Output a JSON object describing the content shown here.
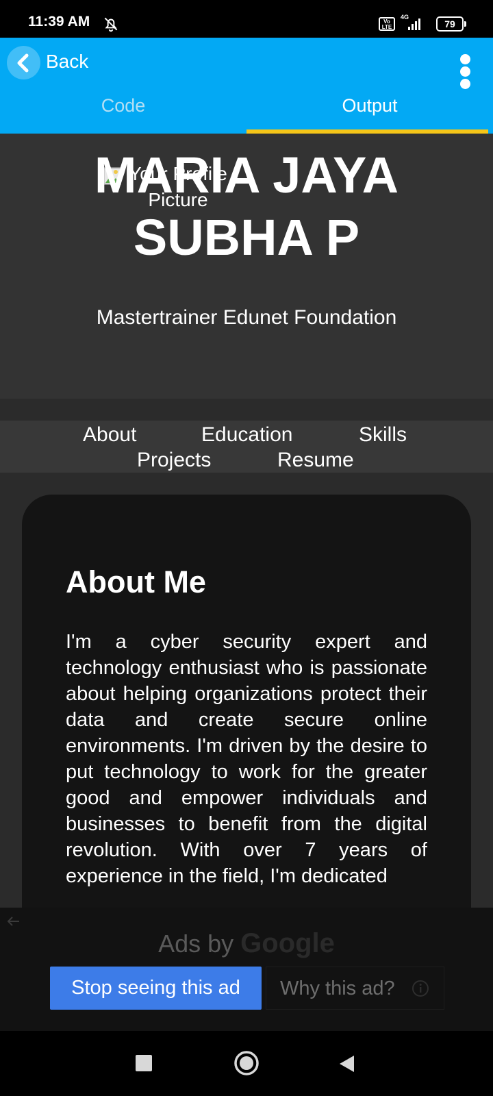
{
  "status_bar": {
    "time": "11:39 AM",
    "volte": "Vo LTE",
    "network": "4G",
    "battery": "79"
  },
  "app_bar": {
    "back_label": "Back",
    "tabs": [
      {
        "label": "Code",
        "selected": false
      },
      {
        "label": "Output",
        "selected": true
      }
    ],
    "accent_color": "#03a9f4",
    "indicator_color": "#f5c518"
  },
  "page": {
    "profile_picture_alt": "Your Profile Picture",
    "name": "MARIA JAYA SUBHA P",
    "role": "Mastertrainer Edunet Foundation",
    "nav": [
      "About",
      "Education",
      "Skills",
      "Projects",
      "Resume"
    ],
    "about": {
      "title": "About Me",
      "text": "I'm a cyber security expert and technology enthusiast who is passionate about helping organizations protect their data and create secure online environments. I'm driven by the desire to put technology to work for the greater good and empower individuals and businesses to benefit from the digital revolution. With over 7 years of experience in the field, I'm dedicated"
    }
  },
  "ad": {
    "ads_by": "Ads by",
    "brand": "Google",
    "stop_label": "Stop seeing this ad",
    "why_label": "Why this ad?"
  },
  "icons": {
    "status": [
      "bell-off-icon",
      "signal-icon",
      "battery-icon"
    ],
    "app_bar": [
      "chevron-left-icon",
      "more-vert-icon"
    ],
    "system_nav": [
      "recents-icon",
      "home-icon",
      "back-triangle-icon"
    ]
  }
}
